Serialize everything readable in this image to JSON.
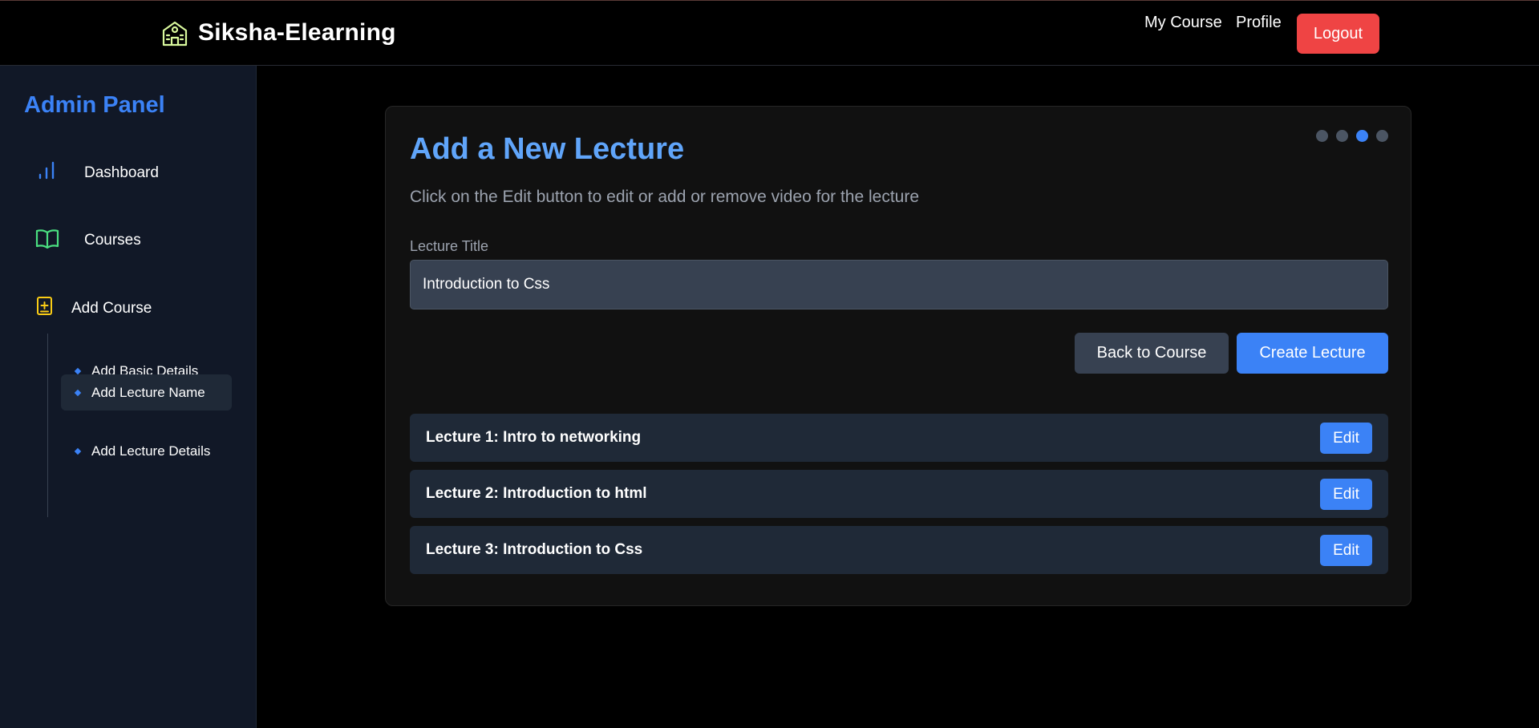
{
  "navbar": {
    "brand": "Siksha-Elearning",
    "links": [
      "My Course",
      "Profile"
    ],
    "logout_label": "Logout"
  },
  "sidebar": {
    "title": "Admin Panel",
    "items": [
      {
        "label": "Dashboard",
        "icon": "bar-chart-icon"
      },
      {
        "label": "Courses",
        "icon": "book-icon"
      },
      {
        "label": "Add Course",
        "icon": "add-file-icon"
      }
    ],
    "sub_items": [
      {
        "label": "Add Basic Details"
      },
      {
        "label": "Add Lecture Name",
        "active": true
      },
      {
        "label": "Add Lecture Details"
      }
    ]
  },
  "main": {
    "title": "Add a New Lecture",
    "subtitle": "Click on the Edit button to edit or add or remove video for the lecture",
    "field_label": "Lecture Title",
    "input_value": "Introduction to Css",
    "back_label": "Back to Course",
    "create_label": "Create Lecture",
    "steps": {
      "total": 4,
      "current": 3
    },
    "lectures": [
      {
        "name": "Lecture 1: Intro to networking",
        "edit_label": "Edit"
      },
      {
        "name": "Lecture 2: Introduction to html",
        "edit_label": "Edit"
      },
      {
        "name": "Lecture 3: Introduction to Css",
        "edit_label": "Edit"
      }
    ]
  },
  "colors": {
    "accent": "#3b82f6",
    "title_blue": "#60a5fa",
    "logout": "#ef4444",
    "sidebar_bg": "#111827",
    "card_bg": "#111111",
    "row_bg": "#1f2937",
    "brand_icon": "#d9f99d",
    "courses_icon": "#4ade80",
    "addcourse_icon": "#facc15"
  }
}
